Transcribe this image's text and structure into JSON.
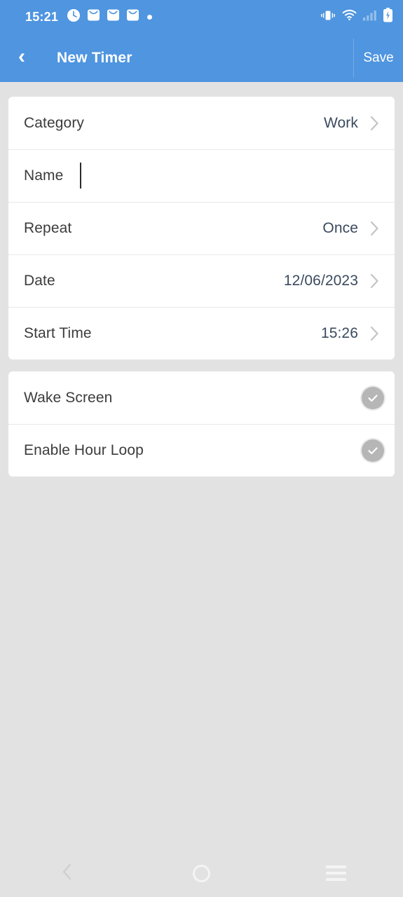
{
  "status_bar": {
    "time": "15:21",
    "left_icons": [
      "clock-icon",
      "mail-icon",
      "mail-icon",
      "mail-icon",
      "dot-indicator-icon"
    ],
    "right_icons": [
      "vibrate-icon",
      "wifi-icon",
      "cellular-signal-icon",
      "battery-charging-icon"
    ],
    "accent_color": "#4f95e0"
  },
  "app_bar": {
    "back_label": "‹",
    "title": "New Timer",
    "save_label": "Save",
    "background_color": "#4f95e0"
  },
  "settings_card": {
    "rows": [
      {
        "label": "Category",
        "value": "Work",
        "has_chevron": true,
        "type": "navigation"
      },
      {
        "label": "Name",
        "value": "",
        "has_chevron": false,
        "type": "text-input",
        "placeholder": ""
      },
      {
        "label": "Repeat",
        "value": "Once",
        "has_chevron": true,
        "type": "navigation"
      },
      {
        "label": "Date",
        "value": "12/06/2023",
        "has_chevron": true,
        "type": "navigation"
      },
      {
        "label": "Start Time",
        "value": "15:26",
        "has_chevron": true,
        "type": "navigation"
      }
    ]
  },
  "options_card": {
    "rows": [
      {
        "label": "Wake Screen",
        "checked": true,
        "icon": "check-circle-icon"
      },
      {
        "label": "Enable Hour Loop",
        "checked": true,
        "icon": "check-circle-icon"
      }
    ]
  },
  "nav_bar": {
    "items": [
      {
        "name": "back",
        "icon": "chevron-left-icon"
      },
      {
        "name": "home",
        "icon": "circle-icon"
      },
      {
        "name": "recents",
        "icon": "hamburger-icon"
      }
    ]
  },
  "colors": {
    "header_blue": "#4f95e0",
    "page_background": "#e2e2e2",
    "card_background": "#ffffff",
    "label_text": "#3c3c3c",
    "value_text": "#3a4a5e",
    "chevron_grey": "#c4c4c4",
    "check_grey": "#b6b6b6"
  }
}
